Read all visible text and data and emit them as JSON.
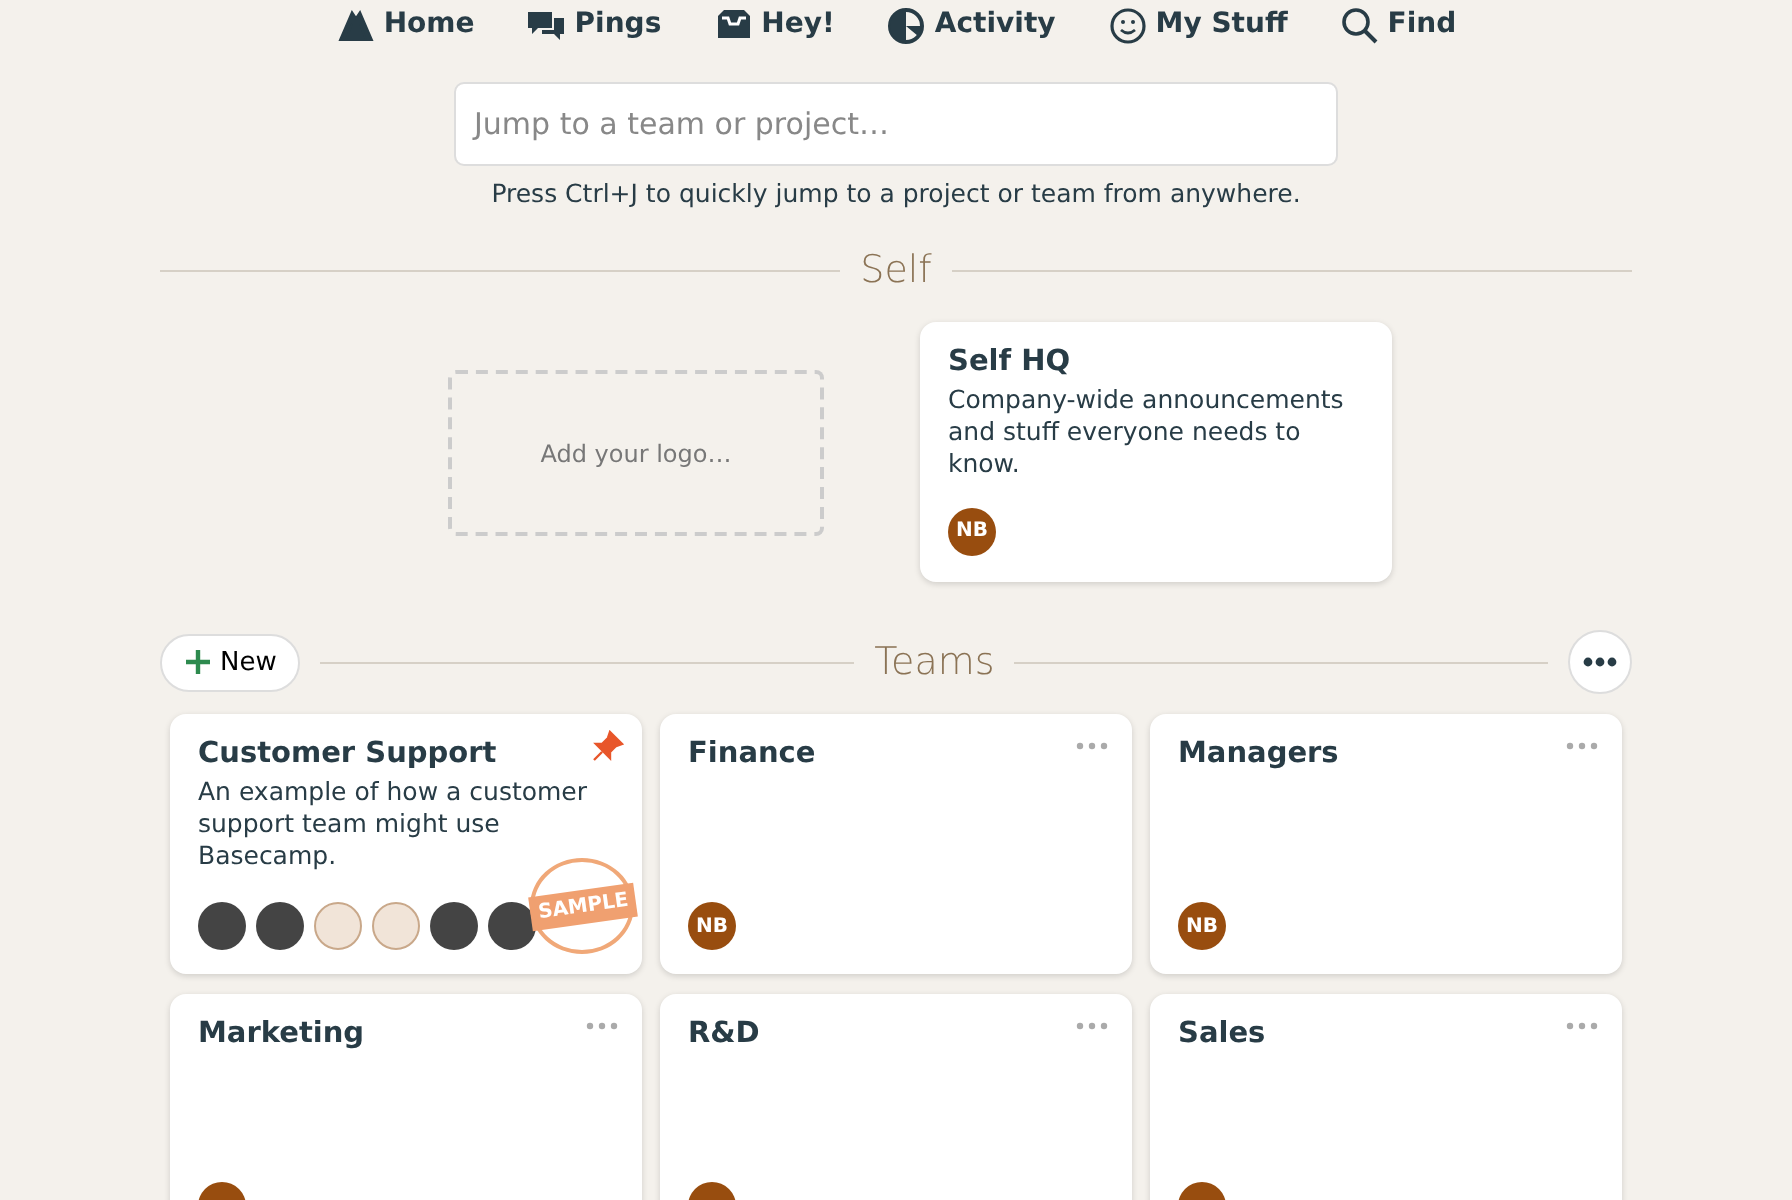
{
  "nav": [
    {
      "label": "Home"
    },
    {
      "label": "Pings"
    },
    {
      "label": "Hey!"
    },
    {
      "label": "Activity"
    },
    {
      "label": "My Stuff"
    },
    {
      "label": "Find"
    }
  ],
  "jump": {
    "placeholder": "Jump to a team or project…",
    "hint": "Press Ctrl+J to quickly jump to a project or team from anywhere."
  },
  "self": {
    "heading": "Self",
    "logo_placeholder": "Add your logo…",
    "hq": {
      "title": "Self HQ",
      "description": "Company-wide announcements and stuff everyone needs to know.",
      "members": [
        {
          "kind": "initials",
          "initials": "NB"
        }
      ]
    }
  },
  "teams": {
    "heading": "Teams",
    "new_button": "New",
    "items": [
      {
        "title": "Customer Support",
        "description": "An example of how a customer support team might use Basecamp.",
        "pinned": true,
        "stamp": "SAMPLE",
        "menu": false,
        "members": [
          {
            "kind": "photo"
          },
          {
            "kind": "photo"
          },
          {
            "kind": "illustration"
          },
          {
            "kind": "illustration"
          },
          {
            "kind": "photo"
          },
          {
            "kind": "photo"
          }
        ]
      },
      {
        "title": "Finance",
        "pinned": false,
        "menu": true,
        "members": [
          {
            "kind": "initials",
            "initials": "NB"
          }
        ]
      },
      {
        "title": "Managers",
        "pinned": false,
        "menu": true,
        "members": [
          {
            "kind": "initials",
            "initials": "NB"
          }
        ]
      },
      {
        "title": "Marketing",
        "pinned": false,
        "menu": true,
        "members": [
          {
            "kind": "hidden"
          }
        ]
      },
      {
        "title": "R&D",
        "pinned": false,
        "menu": true,
        "members": [
          {
            "kind": "hidden"
          }
        ]
      },
      {
        "title": "Sales",
        "pinned": false,
        "menu": true,
        "members": [
          {
            "kind": "hidden"
          }
        ]
      }
    ]
  }
}
